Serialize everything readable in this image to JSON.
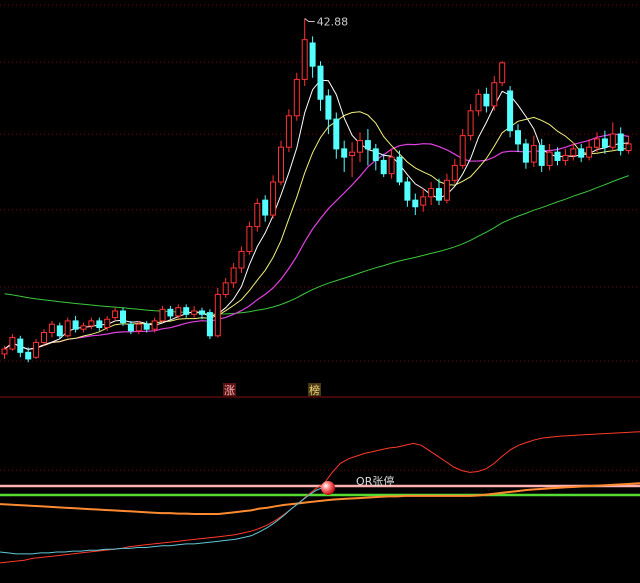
{
  "chart_data": [
    {
      "type": "candlestick",
      "title": "",
      "peak_label": "42.88",
      "markers": [
        "涨",
        "榜"
      ],
      "grid": true,
      "colors": {
        "up": "#ff3333",
        "down": "#54ffff",
        "ma5": "#ffffff",
        "ma10": "#f2f27a",
        "ma20": "#e040e0",
        "ma60": "#3cc83c"
      },
      "candles": [
        {
          "o": 22.6,
          "c": 22.9,
          "h": 23.1,
          "l": 22.3
        },
        {
          "o": 22.9,
          "c": 23.6,
          "h": 23.8,
          "l": 22.8
        },
        {
          "o": 23.5,
          "c": 22.7,
          "h": 23.7,
          "l": 22.4
        },
        {
          "o": 22.7,
          "c": 22.3,
          "h": 23.0,
          "l": 22.1
        },
        {
          "o": 22.4,
          "c": 23.3,
          "h": 23.5,
          "l": 22.3
        },
        {
          "o": 23.3,
          "c": 23.9,
          "h": 24.1,
          "l": 23.1
        },
        {
          "o": 23.9,
          "c": 24.4,
          "h": 24.6,
          "l": 23.6
        },
        {
          "o": 24.3,
          "c": 23.7,
          "h": 24.5,
          "l": 23.5
        },
        {
          "o": 23.7,
          "c": 24.6,
          "h": 24.8,
          "l": 23.6
        },
        {
          "o": 24.6,
          "c": 24.1,
          "h": 24.9,
          "l": 23.9
        },
        {
          "o": 24.1,
          "c": 24.3,
          "h": 24.5,
          "l": 23.9
        },
        {
          "o": 24.3,
          "c": 24.6,
          "h": 24.8,
          "l": 24.1
        },
        {
          "o": 24.6,
          "c": 24.2,
          "h": 24.8,
          "l": 24.0
        },
        {
          "o": 24.2,
          "c": 24.7,
          "h": 24.9,
          "l": 24.0
        },
        {
          "o": 24.8,
          "c": 25.2,
          "h": 25.4,
          "l": 24.6
        },
        {
          "o": 25.2,
          "c": 24.5,
          "h": 25.4,
          "l": 24.3
        },
        {
          "o": 24.4,
          "c": 24.0,
          "h": 24.6,
          "l": 23.8
        },
        {
          "o": 24.0,
          "c": 24.4,
          "h": 24.6,
          "l": 23.8
        },
        {
          "o": 24.4,
          "c": 24.1,
          "h": 24.6,
          "l": 23.9
        },
        {
          "o": 24.1,
          "c": 24.6,
          "h": 24.8,
          "l": 23.9
        },
        {
          "o": 24.6,
          "c": 25.3,
          "h": 25.5,
          "l": 24.5
        },
        {
          "o": 25.3,
          "c": 24.9,
          "h": 25.5,
          "l": 24.7
        },
        {
          "o": 24.9,
          "c": 25.4,
          "h": 25.6,
          "l": 24.7
        },
        {
          "o": 25.4,
          "c": 25.0,
          "h": 25.6,
          "l": 24.8
        },
        {
          "o": 25.0,
          "c": 25.2,
          "h": 25.5,
          "l": 24.8
        },
        {
          "o": 25.2,
          "c": 25.0,
          "h": 25.4,
          "l": 24.7
        },
        {
          "o": 25.1,
          "c": 23.7,
          "h": 25.3,
          "l": 23.5
        },
        {
          "o": 23.7,
          "c": 26.2,
          "h": 26.6,
          "l": 23.6
        },
        {
          "o": 26.2,
          "c": 26.9,
          "h": 27.2,
          "l": 26.0
        },
        {
          "o": 26.9,
          "c": 27.8,
          "h": 28.1,
          "l": 26.6
        },
        {
          "o": 27.8,
          "c": 28.8,
          "h": 29.1,
          "l": 27.5
        },
        {
          "o": 28.8,
          "c": 30.3,
          "h": 30.6,
          "l": 28.6
        },
        {
          "o": 30.3,
          "c": 31.7,
          "h": 32.0,
          "l": 30.0
        },
        {
          "o": 31.9,
          "c": 31.0,
          "h": 32.2,
          "l": 30.6
        },
        {
          "o": 31.0,
          "c": 33.0,
          "h": 33.4,
          "l": 30.8
        },
        {
          "o": 33.0,
          "c": 35.1,
          "h": 35.5,
          "l": 32.8
        },
        {
          "o": 35.1,
          "c": 37.0,
          "h": 37.4,
          "l": 34.8
        },
        {
          "o": 37.0,
          "c": 39.2,
          "h": 39.6,
          "l": 36.7
        },
        {
          "o": 39.2,
          "c": 41.6,
          "h": 42.88,
          "l": 38.8
        },
        {
          "o": 41.4,
          "c": 40.0,
          "h": 41.8,
          "l": 39.3
        },
        {
          "o": 40.0,
          "c": 38.0,
          "h": 40.3,
          "l": 37.3
        },
        {
          "o": 38.2,
          "c": 36.8,
          "h": 38.6,
          "l": 35.9
        },
        {
          "o": 36.8,
          "c": 35.0,
          "h": 37.2,
          "l": 34.4
        },
        {
          "o": 35.0,
          "c": 34.5,
          "h": 35.5,
          "l": 33.6
        },
        {
          "o": 34.6,
          "c": 34.8,
          "h": 35.4,
          "l": 33.3
        },
        {
          "o": 34.8,
          "c": 35.5,
          "h": 36.0,
          "l": 34.2
        },
        {
          "o": 35.5,
          "c": 35.0,
          "h": 36.2,
          "l": 34.0
        },
        {
          "o": 35.0,
          "c": 34.3,
          "h": 35.3,
          "l": 33.7
        },
        {
          "o": 34.3,
          "c": 33.5,
          "h": 34.7,
          "l": 33.3
        },
        {
          "o": 33.5,
          "c": 34.5,
          "h": 35.0,
          "l": 33.2
        },
        {
          "o": 34.5,
          "c": 33.0,
          "h": 34.9,
          "l": 32.8
        },
        {
          "o": 33.0,
          "c": 31.9,
          "h": 33.3,
          "l": 31.5
        },
        {
          "o": 31.9,
          "c": 31.5,
          "h": 32.3,
          "l": 31.0
        },
        {
          "o": 31.6,
          "c": 32.1,
          "h": 32.6,
          "l": 31.2
        },
        {
          "o": 32.1,
          "c": 32.6,
          "h": 33.0,
          "l": 31.6
        },
        {
          "o": 32.6,
          "c": 31.9,
          "h": 33.2,
          "l": 31.6
        },
        {
          "o": 31.9,
          "c": 33.1,
          "h": 33.5,
          "l": 31.7
        },
        {
          "o": 33.1,
          "c": 34.0,
          "h": 34.4,
          "l": 32.9
        },
        {
          "o": 34.0,
          "c": 35.8,
          "h": 36.2,
          "l": 33.8
        },
        {
          "o": 35.8,
          "c": 37.3,
          "h": 37.7,
          "l": 35.5
        },
        {
          "o": 37.3,
          "c": 38.3,
          "h": 38.6,
          "l": 37.0
        },
        {
          "o": 38.3,
          "c": 37.6,
          "h": 38.7,
          "l": 37.2
        },
        {
          "o": 37.6,
          "c": 39.0,
          "h": 39.4,
          "l": 37.3
        },
        {
          "o": 39.0,
          "c": 40.2,
          "h": 40.3,
          "l": 38.8
        },
        {
          "o": 38.5,
          "c": 36.1,
          "h": 38.8,
          "l": 35.7
        },
        {
          "o": 36.1,
          "c": 35.3,
          "h": 36.5,
          "l": 34.8
        },
        {
          "o": 35.3,
          "c": 34.2,
          "h": 35.6,
          "l": 33.8
        },
        {
          "o": 34.2,
          "c": 35.2,
          "h": 35.8,
          "l": 33.9
        },
        {
          "o": 35.2,
          "c": 34.0,
          "h": 35.6,
          "l": 33.6
        },
        {
          "o": 34.0,
          "c": 34.8,
          "h": 35.3,
          "l": 33.7
        },
        {
          "o": 34.8,
          "c": 34.3,
          "h": 35.1,
          "l": 34.0
        },
        {
          "o": 34.3,
          "c": 34.6,
          "h": 35.0,
          "l": 34.0
        },
        {
          "o": 34.6,
          "c": 35.0,
          "h": 35.4,
          "l": 34.3
        },
        {
          "o": 35.0,
          "c": 34.5,
          "h": 35.3,
          "l": 34.2
        },
        {
          "o": 34.5,
          "c": 35.1,
          "h": 35.6,
          "l": 34.3
        },
        {
          "o": 35.1,
          "c": 35.6,
          "h": 36.0,
          "l": 34.8
        },
        {
          "o": 35.6,
          "c": 35.1,
          "h": 36.1,
          "l": 34.7
        },
        {
          "o": 35.1,
          "c": 35.9,
          "h": 36.6,
          "l": 34.9
        },
        {
          "o": 35.9,
          "c": 34.9,
          "h": 36.3,
          "l": 34.6
        },
        {
          "o": 34.9,
          "c": 35.3,
          "h": 35.8,
          "l": 34.7
        }
      ]
    },
    {
      "type": "line",
      "title": "",
      "label": "OR张停",
      "signal_index": 40,
      "hlines": [
        {
          "y": 0.5,
          "color": "#ffb0b0"
        },
        {
          "y": -0.5,
          "color": "#55dd33"
        }
      ],
      "series": [
        {
          "color": "#ff3a2a",
          "values": [
            -8,
            -7.9,
            -7.8,
            -7.7,
            -7.5,
            -7.4,
            -7.3,
            -7.2,
            -7.1,
            -7.0,
            -6.9,
            -6.8,
            -6.7,
            -6.6,
            -6.5,
            -6.4,
            -6.2,
            -6.1,
            -6.0,
            -5.9,
            -5.8,
            -5.7,
            -5.6,
            -5.5,
            -5.4,
            -5.3,
            -5.2,
            -5.1,
            -5.0,
            -4.9,
            -4.7,
            -4.5,
            -4.2,
            -3.8,
            -3.3,
            -2.7,
            -2.0,
            -1.3,
            -0.5,
            0.2,
            0.8,
            2.0,
            3.0,
            3.5,
            3.8,
            4.1,
            4.3,
            4.5,
            4.7,
            4.8,
            5.0,
            5.2,
            5.0,
            4.4,
            3.8,
            3.2,
            2.6,
            2.2,
            2.0,
            2.1,
            2.4,
            3.0,
            3.8,
            4.5,
            5.0,
            5.3,
            5.6,
            5.8,
            5.9,
            6.0,
            6.05,
            6.1,
            6.15,
            6.2,
            6.25,
            6.3,
            6.35,
            6.4,
            6.45,
            6.5
          ]
        },
        {
          "color": "#ff8a30",
          "values": [
            -1.5,
            -1.55,
            -1.6,
            -1.65,
            -1.7,
            -1.75,
            -1.8,
            -1.85,
            -1.9,
            -1.95,
            -2.0,
            -2.05,
            -2.1,
            -2.15,
            -2.2,
            -2.25,
            -2.3,
            -2.35,
            -2.4,
            -2.45,
            -2.5,
            -2.5,
            -2.55,
            -2.55,
            -2.6,
            -2.6,
            -2.6,
            -2.6,
            -2.5,
            -2.4,
            -2.3,
            -2.2,
            -2.0,
            -1.9,
            -1.75,
            -1.6,
            -1.5,
            -1.4,
            -1.3,
            -1.2,
            -1.1,
            -1.0,
            -0.95,
            -0.9,
            -0.85,
            -0.8,
            -0.75,
            -0.7,
            -0.65,
            -0.65,
            -0.6,
            -0.6,
            -0.6,
            -0.6,
            -0.6,
            -0.6,
            -0.6,
            -0.6,
            -0.6,
            -0.55,
            -0.45,
            -0.35,
            -0.25,
            -0.15,
            -0.05,
            0.05,
            0.12,
            0.18,
            0.25,
            0.3,
            0.35,
            0.4,
            0.45,
            0.5,
            0.55,
            0.6,
            0.65,
            0.7,
            0.75,
            0.8
          ]
        },
        {
          "color": "#5fc8d8",
          "values": [
            -6.8,
            -6.9,
            -7.0,
            -7.0,
            -7.0,
            -6.9,
            -6.9,
            -6.8,
            -6.8,
            -6.7,
            -6.7,
            -6.6,
            -6.6,
            -6.5,
            -6.5,
            -6.4,
            -6.4,
            -6.3,
            -6.3,
            -6.2,
            -6.1,
            -6.1,
            -6.0,
            -5.9,
            -5.9,
            -5.8,
            -5.7,
            -5.6,
            -5.5,
            -5.4,
            -5.2,
            -5.0,
            -4.6,
            -4.1,
            -3.5,
            -2.8,
            -2.0,
            -1.3,
            -0.6,
            0.0,
            0.4
          ]
        }
      ]
    }
  ]
}
